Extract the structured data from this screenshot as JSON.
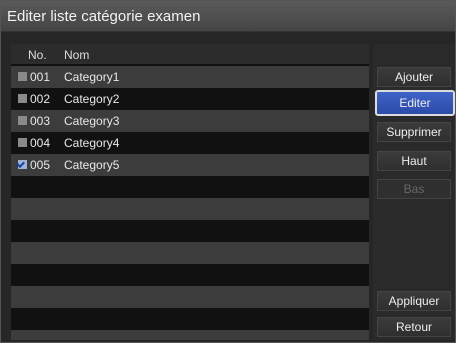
{
  "window": {
    "title": "Editer liste catégorie examen"
  },
  "list": {
    "headers": {
      "no": "No.",
      "nom": "Nom"
    },
    "rows": [
      {
        "no": "001",
        "nom": "Category1",
        "checked": false
      },
      {
        "no": "002",
        "nom": "Category2",
        "checked": false
      },
      {
        "no": "003",
        "nom": "Category3",
        "checked": false
      },
      {
        "no": "004",
        "nom": "Category4",
        "checked": false
      },
      {
        "no": "005",
        "nom": "Category5",
        "checked": true
      }
    ]
  },
  "buttons": {
    "ajouter": "Ajouter",
    "editer": "Editer",
    "supprimer": "Supprimer",
    "haut": "Haut",
    "bas": "Bas",
    "appliquer": "Appliquer",
    "retour": "Retour"
  },
  "colors": {
    "accent": "#3457b8",
    "checkbox_checked": "#9fb3d9"
  }
}
